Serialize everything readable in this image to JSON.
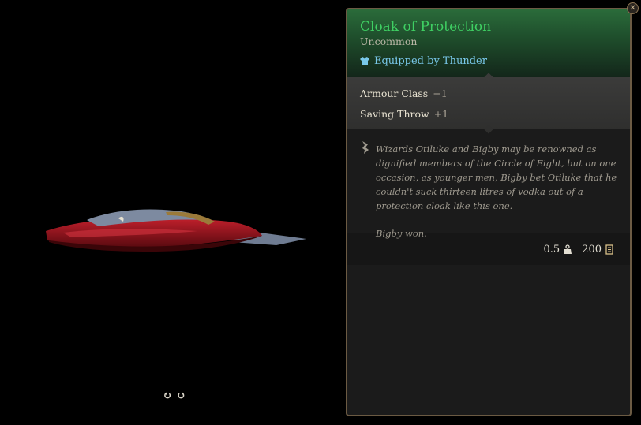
{
  "item": {
    "name": "Cloak of Protection",
    "rarity": "Uncommon",
    "equipped_by": "Equipped by Thunder",
    "colors": {
      "name": "#3fcf63",
      "equipped": "#79c8ea"
    }
  },
  "stats": [
    {
      "label": "Armour Class",
      "value": "+1"
    },
    {
      "label": "Saving Throw",
      "value": "+1"
    }
  ],
  "description": {
    "paragraph_1": "Wizards Otiluke and Bigby may be renowned as dignified members of the Circle of Eight, but on one occasion, as younger men, Bigby bet Otiluke that he couldn't suck thirteen litres of vodka out of a protection cloak like this one.",
    "paragraph_2": "Bigby won."
  },
  "footer": {
    "weight": "0.5",
    "value": "200"
  },
  "icons": {
    "equipped": "shirt-icon",
    "description": "quill-icon",
    "weight": "weight-icon",
    "value": "gold-icon",
    "close": "close-icon",
    "rotate_left": "rotate-left-icon",
    "rotate_right": "rotate-right-icon"
  },
  "rotate": {
    "left_glyph": "↻",
    "right_glyph": "↺"
  },
  "close_glyph": "✕"
}
